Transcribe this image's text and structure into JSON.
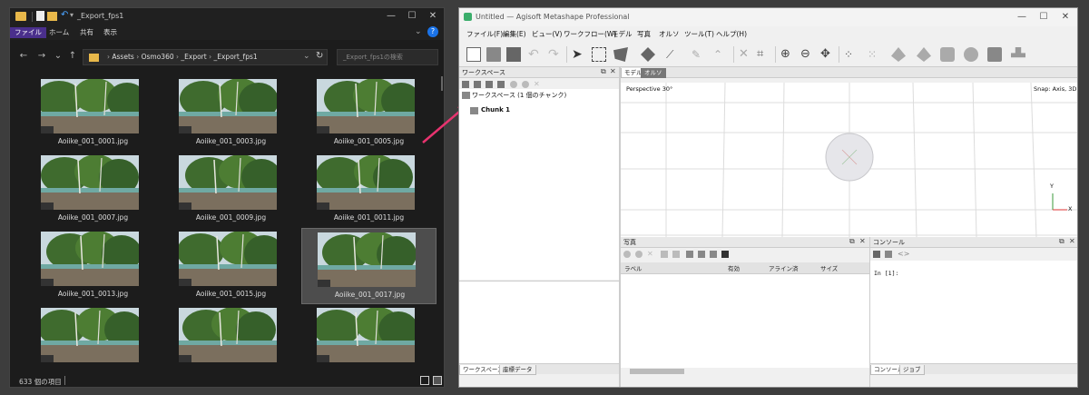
{
  "explorer": {
    "title": "_Export_fps1",
    "menu": [
      "ファイル",
      "ホーム",
      "共有",
      "表示"
    ],
    "breadcrumb": [
      "Assets",
      "Osmo360",
      "_Export",
      "_Export_fps1"
    ],
    "search_placeholder": "_Export_fps1の検索",
    "files": [
      "Aoiike_001_0001.jpg",
      "Aoiike_001_0003.jpg",
      "Aoiike_001_0005.jpg",
      "Aoiike_001_0007.jpg",
      "Aoiike_001_0009.jpg",
      "Aoiike_001_0011.jpg",
      "Aoiike_001_0013.jpg",
      "Aoiike_001_0015.jpg",
      "Aoiike_001_0017.jpg",
      "",
      "",
      ""
    ],
    "selected_index": 8,
    "status": "633 個の項目",
    "colors": {
      "menu_active": "#4a2f8c",
      "selection": "#4d4d4d"
    }
  },
  "metashape": {
    "title": "Untitled — Agisoft Metashape Professional",
    "menu": [
      "ファイル(F)",
      "編集(E)",
      "ビュー(V)",
      "ワークフロー(W)",
      "モデル",
      "写真",
      "オルソ",
      "ツール(T)",
      "ヘルプ(H)"
    ],
    "workspace": {
      "header": "ワークスペース",
      "root": "ワークスペース (1 個のチャンク)",
      "chunk": "Chunk 1",
      "tabs": [
        "ワークスペース",
        "座標データ"
      ]
    },
    "model": {
      "tabs": [
        "モデル",
        "オルソ"
      ],
      "perspective": "Perspective 30°",
      "snap": "Snap: Axis, 3D",
      "axis_y": "Y",
      "axis_x": "X"
    },
    "photos": {
      "header": "写真",
      "columns": [
        "ラベル",
        "有効",
        "アライン済",
        "サイズ"
      ]
    },
    "console": {
      "header": "コンソール",
      "prompt": "In [1]:",
      "tabs": [
        "コンソール",
        "ジョブ"
      ]
    }
  }
}
